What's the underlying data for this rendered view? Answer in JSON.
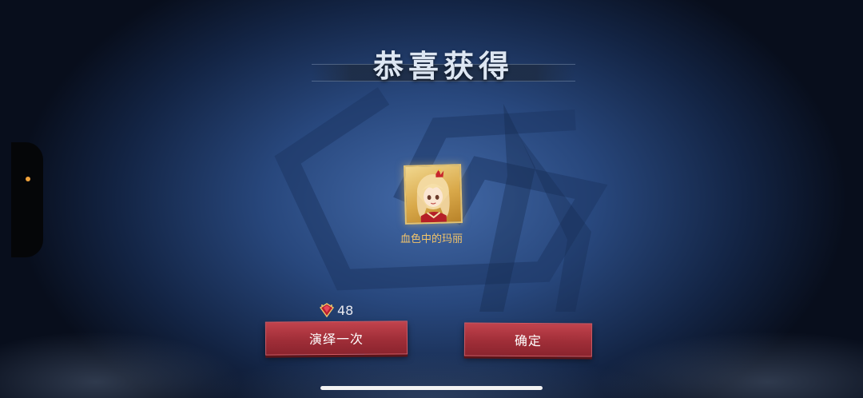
{
  "title": "恭喜获得",
  "reward": {
    "name": "血色中的玛丽",
    "icon": "portrait-mary-icon"
  },
  "cost": {
    "icon": "crystal-gem-icon",
    "value": "48"
  },
  "buttons": {
    "replay_label": "演绎一次",
    "confirm_label": "确定"
  },
  "colors": {
    "button_red": "#a8323c",
    "reward_text": "#f2c46a",
    "card_gold": "#d9a94a",
    "notch_indicator": "#f0a23a"
  }
}
